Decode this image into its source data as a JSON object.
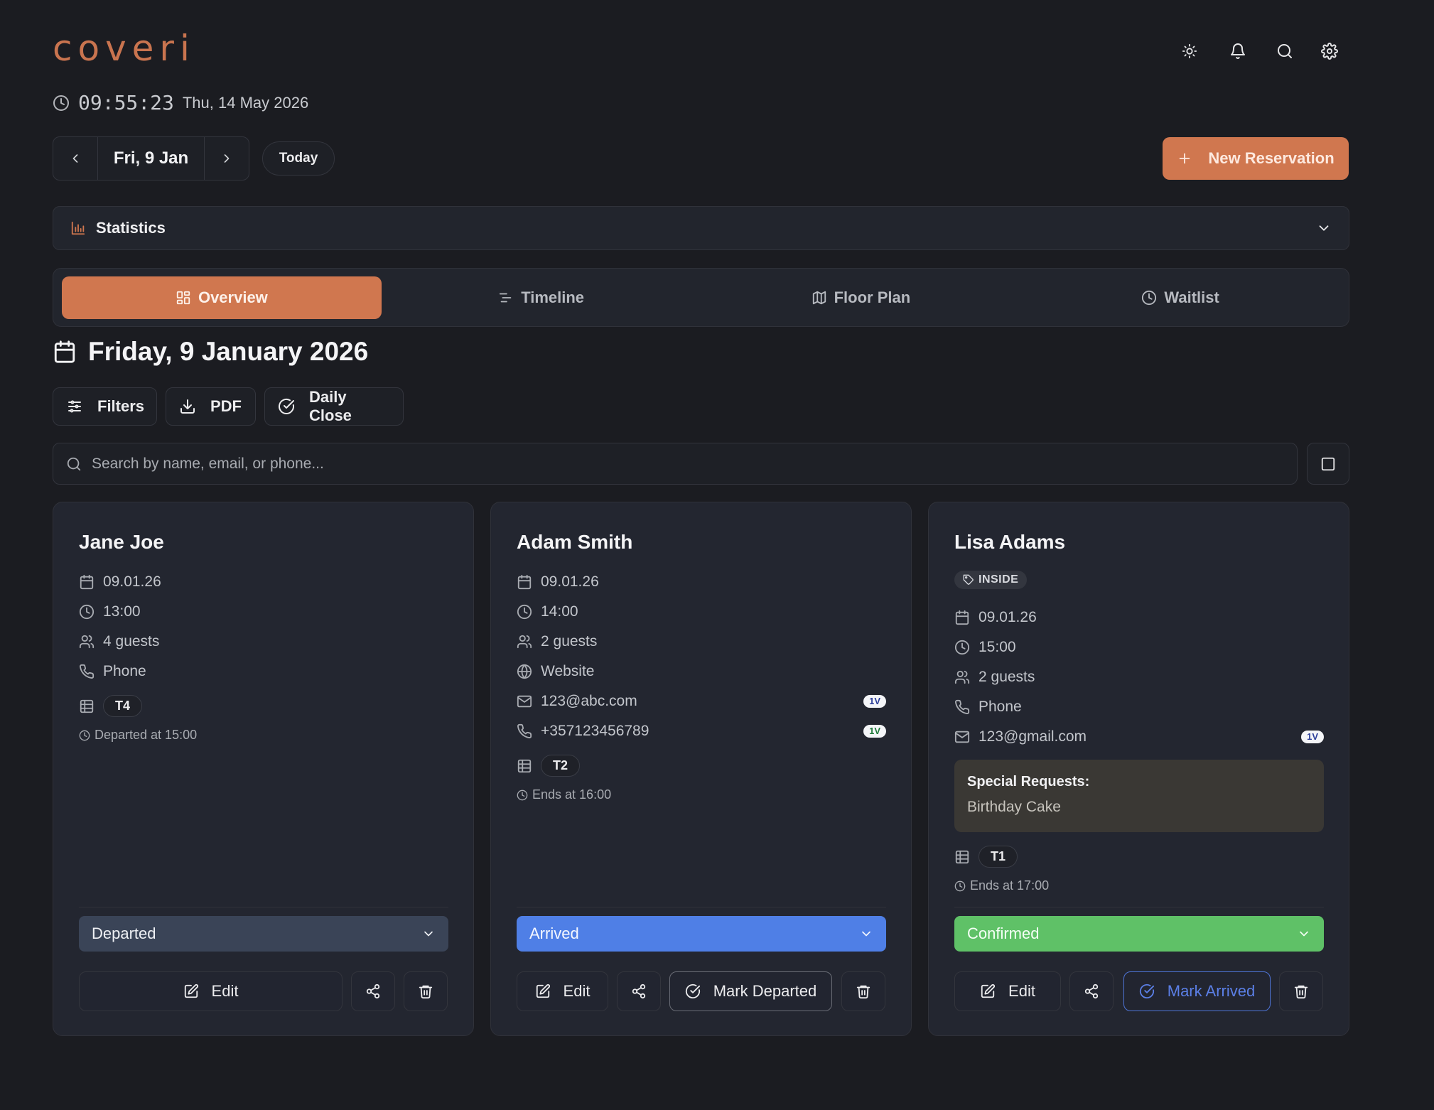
{
  "app": {
    "logo": "coveri"
  },
  "header_icons": [
    "sun-icon",
    "bell-icon",
    "search-icon",
    "gear-icon"
  ],
  "clock": {
    "time": "09:55:23",
    "date": "Thu, 14 May 2026"
  },
  "date_nav": {
    "label": "Fri, 9 Jan",
    "today": "Today"
  },
  "new_reservation": "New Reservation",
  "statistics": "Statistics",
  "tabs": [
    {
      "label": "Overview",
      "icon": "grid-icon",
      "active": true
    },
    {
      "label": "Timeline",
      "icon": "timeline-icon"
    },
    {
      "label": "Floor Plan",
      "icon": "map-icon"
    },
    {
      "label": "Waitlist",
      "icon": "clock-icon"
    }
  ],
  "day_title": "Friday, 9 January 2026",
  "toolbar": {
    "filters": "Filters",
    "pdf": "PDF",
    "daily_close": "Daily Close"
  },
  "search": {
    "placeholder": "Search by name, email, or phone..."
  },
  "colors": {
    "accent": "#d0774f",
    "departed": "#3a4457",
    "arrived": "#4f7fe6",
    "confirmed": "#5fc167",
    "mark_arrived": "#5b7fe6"
  },
  "cards": [
    {
      "name": "Jane Joe",
      "date": "09.01.26",
      "time": "13:00",
      "guests": "4 guests",
      "source": "Phone",
      "table": "T4",
      "note": "Departed at 15:00",
      "status": "Departed",
      "actions": {
        "edit": "Edit"
      }
    },
    {
      "name": "Adam Smith",
      "date": "09.01.26",
      "time": "14:00",
      "guests": "2 guests",
      "source": "Website",
      "email": "123@abc.com",
      "email_badge": "1V",
      "phone": "+357123456789",
      "phone_badge": "1V",
      "table": "T2",
      "note": "Ends at 16:00",
      "status": "Arrived",
      "actions": {
        "edit": "Edit",
        "mark": "Mark Departed"
      }
    },
    {
      "name": "Lisa Adams",
      "tag": "INSIDE",
      "date": "09.01.26",
      "time": "15:00",
      "guests": "2 guests",
      "source": "Phone",
      "email": "123@gmail.com",
      "email_badge": "1V",
      "special_title": "Special Requests:",
      "special_value": "Birthday Cake",
      "table": "T1",
      "note": "Ends at 17:00",
      "status": "Confirmed",
      "actions": {
        "edit": "Edit",
        "mark": "Mark Arrived"
      }
    }
  ]
}
